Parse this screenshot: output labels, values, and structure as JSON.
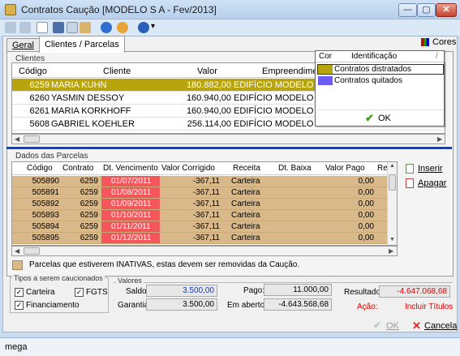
{
  "window": {
    "title": "Contratos Caução [MODELO S A - Fev/2013]",
    "minimize_glyph": "—",
    "maximize_glyph": "▢",
    "close_glyph": "✕"
  },
  "toolbar": {
    "icons": [
      "undo-icon",
      "redo-icon",
      "new-icon",
      "cut-icon",
      "copy-icon",
      "paste-icon",
      "info-icon",
      "users-icon",
      "help-icon"
    ],
    "dropdown_glyph": "▾"
  },
  "tabs": [
    {
      "label": "Geral"
    },
    {
      "label": "Clientes / Parcelas"
    }
  ],
  "cores_button": {
    "label": "Cores"
  },
  "clientes": {
    "group_label": "Clientes",
    "columns": [
      "Código",
      "Cliente",
      "Valor",
      "Empreendimento"
    ],
    "rows": [
      {
        "codigo": "6259",
        "cliente": "MARIA KUHN",
        "valor": "180.882,00",
        "empreendimento": "EDIFÍCIO MODELO"
      },
      {
        "codigo": "6260",
        "cliente": "YASMIN DESSOY",
        "valor": "160.940,00",
        "empreendimento": "EDIFÍCIO MODELO"
      },
      {
        "codigo": "6261",
        "cliente": "MARIA KORKHOFF",
        "valor": "160.940,00",
        "empreendimento": "EDIFÍCIO MODELO"
      },
      {
        "codigo": "5608",
        "cliente": "GABRIEL KOEHLER",
        "valor": "256.114,00",
        "empreendimento": "EDIFÍCIO MODELO"
      }
    ]
  },
  "legend_popup": {
    "col_cor": "Cor",
    "col_identificacao": "Identificação",
    "col_sort": "/",
    "items": [
      {
        "label": "Contratos distratados",
        "color": "#b8a40c"
      },
      {
        "label": "Contratos quitados",
        "color": "#6d5cf5"
      }
    ],
    "ok_label": "OK"
  },
  "parcelas": {
    "group_label": "Dados das Parcelas",
    "columns": [
      "Código",
      "Contrato",
      "Dt. Vencimento",
      "Valor Corrigido",
      "Receita",
      "Dt. Baixa",
      "Valor Pago",
      "Re"
    ],
    "rows": [
      {
        "codigo": "505890",
        "contrato": "6259",
        "vencimento": "01/07/2011",
        "valor": "-367,11",
        "receita": "Carteira",
        "baixa": "",
        "pago": "0,00"
      },
      {
        "codigo": "505891",
        "contrato": "6259",
        "vencimento": "01/08/2011",
        "valor": "-367,11",
        "receita": "Carteira",
        "baixa": "",
        "pago": "0,00"
      },
      {
        "codigo": "505892",
        "contrato": "6259",
        "vencimento": "01/09/2011",
        "valor": "-367,11",
        "receita": "Carteira",
        "baixa": "",
        "pago": "0,00"
      },
      {
        "codigo": "505893",
        "contrato": "6259",
        "vencimento": "01/10/2011",
        "valor": "-367,11",
        "receita": "Carteira",
        "baixa": "",
        "pago": "0,00"
      },
      {
        "codigo": "505894",
        "contrato": "6259",
        "vencimento": "01/11/2011",
        "valor": "-367,11",
        "receita": "Carteira",
        "baixa": "",
        "pago": "0,00"
      },
      {
        "codigo": "505895",
        "contrato": "6259",
        "vencimento": "01/12/2011",
        "valor": "-367,11",
        "receita": "Carteira",
        "baixa": "",
        "pago": "0,00"
      }
    ],
    "inserir_label": "Inserir",
    "apagar_label": "Apagar"
  },
  "notice": {
    "text": "Parcelas que estiverem INATIVAS, estas devem ser removidas da Caução."
  },
  "tipos": {
    "group_label": "Tipos a serem caucionados",
    "carteira": "Carteira",
    "fgts": "FGTS",
    "financiamento": "Financiamento"
  },
  "valores": {
    "group_label": "Valores",
    "saldo_label": "Saldo:",
    "saldo_value": "3.500,00",
    "garantia_label": "Garantia:",
    "garantia_value": "3.500,00",
    "pago_label": "Pago:",
    "pago_value": "11.000,00",
    "aberto_label": "Em aberto:",
    "aberto_value": "-4.643.568,68",
    "resultado_label": "Resultado:",
    "resultado_value": "-4.647.068,68",
    "acao_label": "Ação:",
    "acao_value": "Incluir Títulos"
  },
  "footer": {
    "ok_label": "OK",
    "cancel_label": "Cancela"
  },
  "statusbar": {
    "text": "mega"
  },
  "colors": {
    "accent": "#0a3fd8",
    "selected": "#b8a40c",
    "parcel_row": "#d9b98a",
    "overdue": "#f3575b",
    "alert_text": "#e00000"
  }
}
